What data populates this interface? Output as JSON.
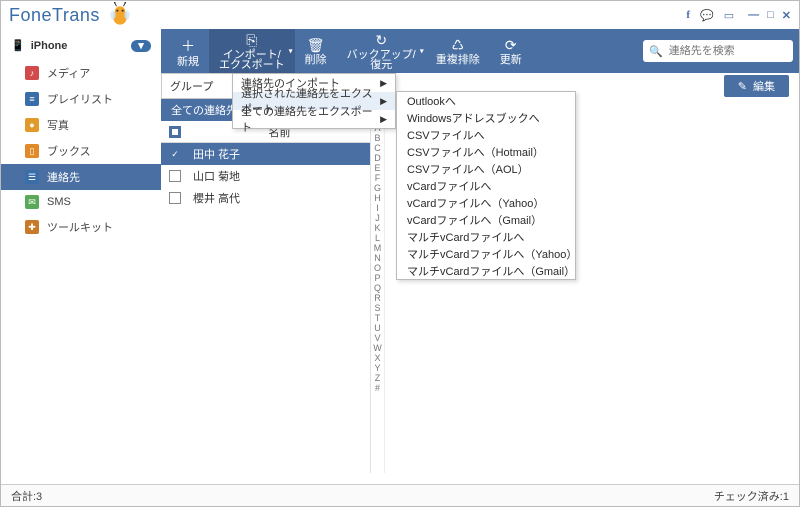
{
  "brand": "FoneTrans",
  "header_icons": {
    "fb": "f",
    "chat": "💬",
    "feedback": "▭",
    "min": "—",
    "max": "□",
    "close": "✕"
  },
  "device": {
    "name": "iPhone",
    "badge": "▾"
  },
  "sidebar": [
    {
      "icon_bg": "#d34a4a",
      "icon": "♪",
      "label": "メディア"
    },
    {
      "icon_bg": "#3a6ea8",
      "icon": "≡",
      "label": "プレイリスト"
    },
    {
      "icon_bg": "#e09a2a",
      "icon": "●",
      "label": "写真"
    },
    {
      "icon_bg": "#e08a2a",
      "icon": "▯",
      "label": "ブックス"
    },
    {
      "icon_bg": "#3a6ea8",
      "icon": "☰",
      "label": "連絡先",
      "active": true
    },
    {
      "icon_bg": "#5aa85a",
      "icon": "✉",
      "label": "SMS"
    },
    {
      "icon_bg": "#c77a2a",
      "icon": "✚",
      "label": "ツールキット"
    }
  ],
  "toolbar": [
    {
      "icon": "＋",
      "label": "新規"
    },
    {
      "icon": "⎘",
      "label": "インポート/\nエクスポート",
      "caret": true,
      "active": true
    },
    {
      "icon": "🗑",
      "label": "削除"
    },
    {
      "icon": "↻",
      "label": "バックアップ/\n復元",
      "caret": true
    },
    {
      "icon": "♺",
      "label": "重複排除"
    },
    {
      "icon": "⟳",
      "label": "更新"
    }
  ],
  "search": {
    "placeholder": "連絡先を検索",
    "icon": "🔍"
  },
  "group_label": "グループ",
  "edit_button": "編集",
  "edit_icon": "✎",
  "all_contacts": "全ての連絡先（3）",
  "col_name": "名前",
  "contacts": [
    {
      "name": "田中 花子",
      "checked": true,
      "selected": true
    },
    {
      "name": "山口 菊地",
      "checked": false,
      "selected": false
    },
    {
      "name": "櫻井 高代",
      "checked": false,
      "selected": false
    }
  ],
  "alpha": [
    "A",
    "B",
    "C",
    "D",
    "E",
    "F",
    "G",
    "H",
    "I",
    "J",
    "K",
    "L",
    "M",
    "N",
    "O",
    "P",
    "Q",
    "R",
    "S",
    "T",
    "U",
    "V",
    "W",
    "X",
    "Y",
    "Z",
    "#"
  ],
  "menu1": [
    {
      "label": "連絡先のインポート",
      "arrow": true
    },
    {
      "label": "選択された連絡先をエクスポート",
      "arrow": true,
      "hover": true
    },
    {
      "label": "全ての連絡先をエクスポート",
      "arrow": true
    }
  ],
  "menu2": [
    "Outlookへ",
    "Windowsアドレスブックへ",
    "CSVファイルへ",
    "CSVファイルへ（Hotmail）",
    "CSVファイルへ（AOL）",
    "vCardファイルへ",
    "vCardファイルへ（Yahoo）",
    "vCardファイルへ（Gmail）",
    "マルチvCardファイルへ",
    "マルチvCardファイルへ（Yahoo）",
    "マルチvCardファイルへ（Gmail）"
  ],
  "status": {
    "total": "合計:3",
    "checked": "チェック済み:1"
  }
}
